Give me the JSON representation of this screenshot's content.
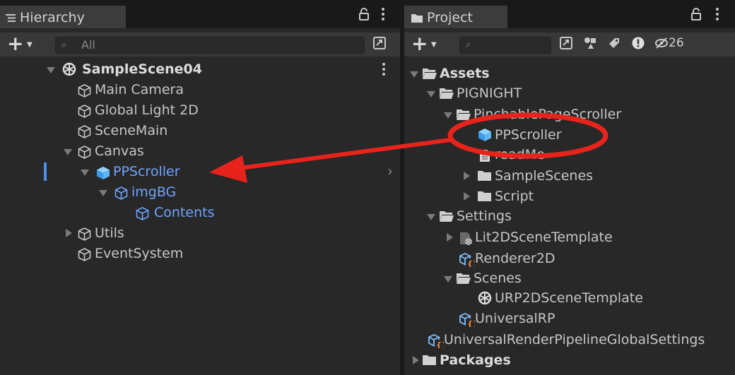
{
  "hierarchy": {
    "tab_label": "Hierarchy",
    "search_placeholder": "All",
    "items": [
      {
        "label": "SampleScene04",
        "type": "scene"
      },
      {
        "label": "Main Camera",
        "type": "gameobject"
      },
      {
        "label": "Global Light 2D",
        "type": "gameobject"
      },
      {
        "label": "SceneMain",
        "type": "gameobject"
      },
      {
        "label": "Canvas",
        "type": "gameobject",
        "expanded": true
      },
      {
        "label": "PPScroller",
        "type": "prefab",
        "expanded": true,
        "highlight": true
      },
      {
        "label": "imgBG",
        "type": "gameobject",
        "expanded": true,
        "highlight": true
      },
      {
        "label": "Contents",
        "type": "gameobject",
        "highlight": true
      },
      {
        "label": "Utils",
        "type": "gameobject",
        "expanded": false
      },
      {
        "label": "EventSystem",
        "type": "gameobject"
      }
    ]
  },
  "project": {
    "tab_label": "Project",
    "hidden_count": "26",
    "items": [
      {
        "label": "Assets",
        "type": "folder-open"
      },
      {
        "label": "PIGNIGHT",
        "type": "folder-open"
      },
      {
        "label": "PinchablePageScroller",
        "type": "folder-open"
      },
      {
        "label": "PPScroller",
        "type": "prefab"
      },
      {
        "label": "readMe",
        "type": "file"
      },
      {
        "label": "SampleScenes",
        "type": "folder"
      },
      {
        "label": "Script",
        "type": "folder"
      },
      {
        "label": "Settings",
        "type": "folder-open"
      },
      {
        "label": "Lit2DSceneTemplate",
        "type": "scene-template"
      },
      {
        "label": "Renderer2D",
        "type": "asset"
      },
      {
        "label": "Scenes",
        "type": "folder-open"
      },
      {
        "label": "URP2DSceneTemplate",
        "type": "scene"
      },
      {
        "label": "UniversalRP",
        "type": "asset"
      },
      {
        "label": "UniversalRenderPipelineGlobalSettings",
        "type": "asset"
      },
      {
        "label": "Packages",
        "type": "folder"
      }
    ]
  },
  "colors": {
    "annotation": "#e8231c",
    "highlight_text": "#6ea4ff",
    "selection_bar": "#4f8fe8",
    "panel_bg": "#282828"
  }
}
